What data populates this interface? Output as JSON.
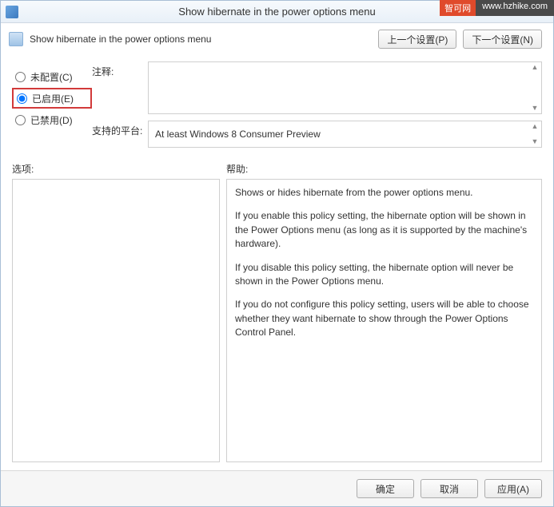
{
  "watermark": {
    "brand": "智可网",
    "url": "www.hzhike.com"
  },
  "window": {
    "title": "Show hibernate in the power options menu"
  },
  "header": {
    "title": "Show hibernate in the power options menu",
    "prev_btn": "上一个设置(P)",
    "next_btn": "下一个设置(N)"
  },
  "radios": {
    "not_configured": "未配置(C)",
    "enabled": "已启用(E)",
    "disabled": "已禁用(D)",
    "selected": "enabled"
  },
  "labels": {
    "comment": "注释:",
    "platform": "支持的平台:",
    "options": "选项:",
    "help": "帮助:"
  },
  "fields": {
    "comment": "",
    "platform": "At least Windows 8 Consumer Preview"
  },
  "help": {
    "p1": "Shows or hides hibernate from the power options menu.",
    "p2": "If you enable this policy setting, the hibernate option will be shown in the Power Options menu (as long as it is supported by the machine's hardware).",
    "p3": "If you disable this policy setting, the hibernate option will never be shown in the Power Options menu.",
    "p4": "If you do not configure this policy setting, users will be able to choose whether they want hibernate to show through the Power Options Control Panel."
  },
  "buttons": {
    "ok": "确定",
    "cancel": "取消",
    "apply": "应用(A)"
  }
}
